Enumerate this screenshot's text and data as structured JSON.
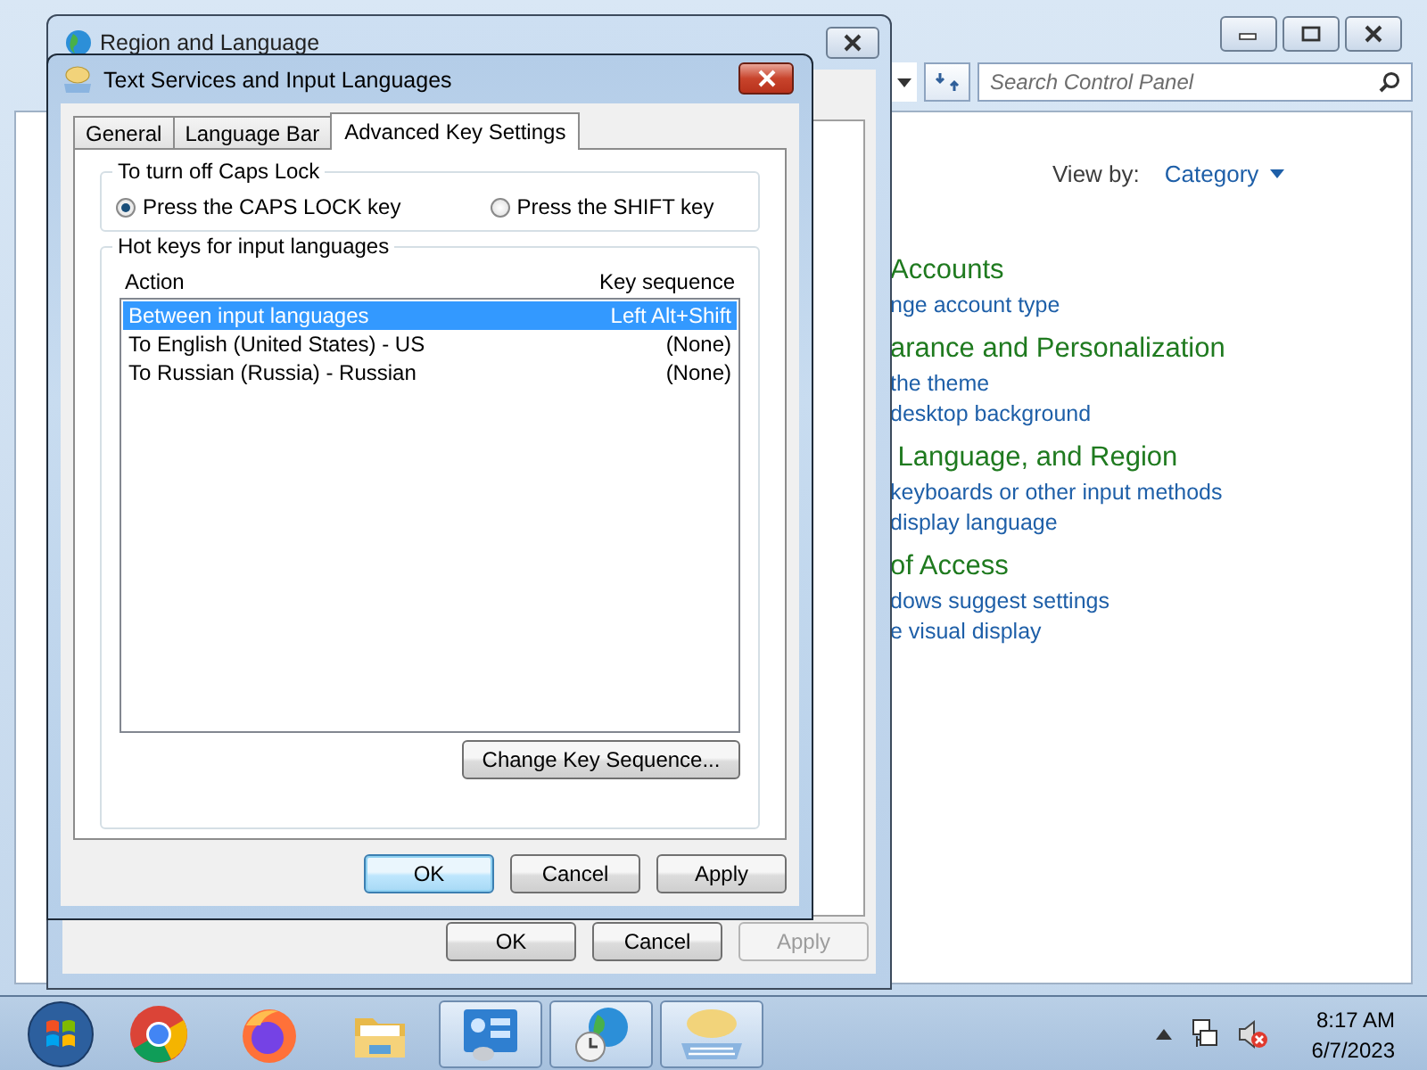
{
  "control_panel": {
    "search": {
      "placeholder": "Search Control Panel"
    },
    "view_by": {
      "label": "View by:",
      "value": "Category"
    },
    "categories": [
      {
        "title": "Accounts",
        "links": [
          "nge account type"
        ]
      },
      {
        "title": "arance and Personalization",
        "links": [
          "the theme",
          "desktop background"
        ]
      },
      {
        "title": " Language, and Region",
        "links": [
          "keyboards or other input methods",
          "display language"
        ]
      },
      {
        "title": "of Access",
        "links": [
          "dows suggest settings",
          "e visual display"
        ]
      }
    ]
  },
  "region_window": {
    "title": "Region and Language",
    "buttons": [
      {
        "label": "OK",
        "disabled": false
      },
      {
        "label": "Cancel",
        "disabled": false
      },
      {
        "label": "Apply",
        "disabled": true
      }
    ]
  },
  "dialog": {
    "title": "Text Services and Input Languages",
    "tabs": [
      {
        "label": "General",
        "selected": false
      },
      {
        "label": "Language Bar",
        "selected": false
      },
      {
        "label": "Advanced Key Settings",
        "selected": true
      }
    ],
    "caps_lock": {
      "title": "To turn off Caps Lock",
      "options": [
        {
          "label": "Press the CAPS LOCK key",
          "selected": true
        },
        {
          "label": "Press the SHIFT key",
          "selected": false
        }
      ]
    },
    "hot_keys": {
      "title": "Hot keys for input languages",
      "columns": [
        "Action",
        "Key sequence"
      ],
      "rows": [
        {
          "action": "Between input languages",
          "key": "Left Alt+Shift",
          "selected": true
        },
        {
          "action": "To English (United States) - US",
          "key": "(None)",
          "selected": false
        },
        {
          "action": "To Russian (Russia) - Russian",
          "key": "(None)",
          "selected": false
        }
      ]
    },
    "change_button": "Change Key Sequence...",
    "buttons": [
      {
        "label": "OK",
        "default": true
      },
      {
        "label": "Cancel",
        "default": false
      },
      {
        "label": "Apply",
        "default": false
      }
    ]
  },
  "taskbar": {
    "apps": [
      {
        "kind": "chrome",
        "active": false
      },
      {
        "kind": "firefox",
        "active": false
      },
      {
        "kind": "explorer",
        "active": false
      },
      {
        "kind": "control-panel",
        "active": true
      },
      {
        "kind": "region",
        "active": true
      },
      {
        "kind": "text-services",
        "active": true
      }
    ],
    "clock": {
      "time": "8:17 AM",
      "date": "6/7/2023"
    }
  }
}
